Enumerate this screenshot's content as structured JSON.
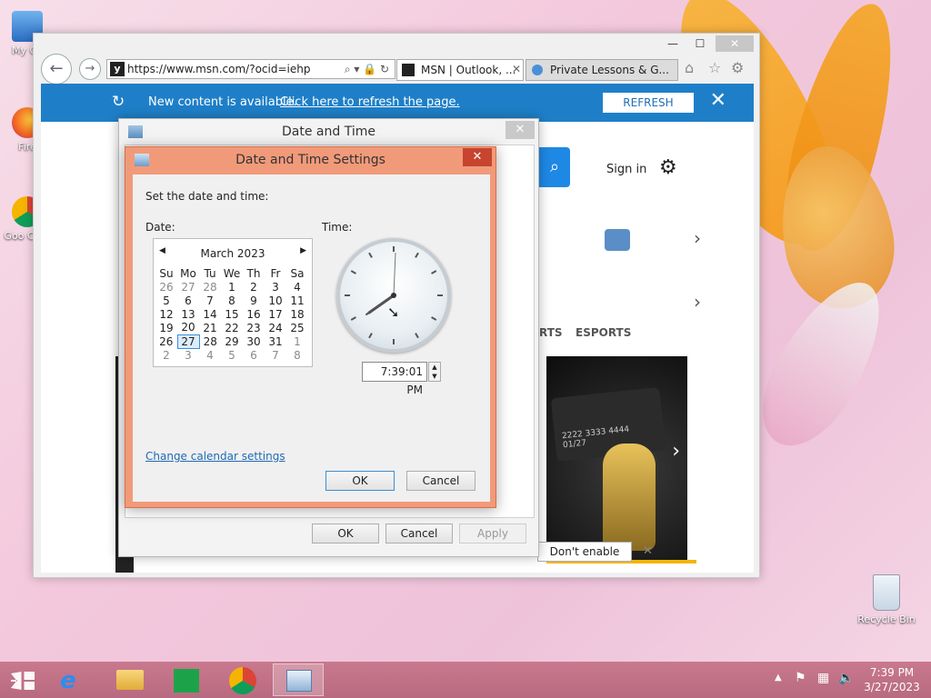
{
  "desktop": {
    "icons": [
      {
        "label": "My Co"
      },
      {
        "label": "Fire"
      },
      {
        "label": "Goo Chro"
      },
      {
        "label": "Recycle Bin"
      }
    ]
  },
  "browser": {
    "url": "https://www.msn.com/?ocid=iehp",
    "tabs": [
      {
        "label": "MSN | Outlook, ..."
      },
      {
        "label": "Private Lessons & G..."
      }
    ],
    "banner": {
      "text": "New content is available.",
      "link": "Click here to refresh the page.",
      "refresh_label": "REFRESH"
    },
    "page": {
      "sign_in": "Sign in",
      "nav": [
        "RTS",
        "ESPORTS"
      ],
      "card_number": "2222 3333 4444",
      "card_exp": "01/27",
      "dont_enable": "Don't enable"
    }
  },
  "outer_dialog": {
    "title": "Date and Time",
    "ok": "OK",
    "cancel": "Cancel",
    "apply": "Apply"
  },
  "inner_dialog": {
    "title": "Date and Time Settings",
    "instruction": "Set the date and time:",
    "date_label": "Date:",
    "time_label": "Time:",
    "month_label": "March 2023",
    "weekdays": [
      "Su",
      "Mo",
      "Tu",
      "We",
      "Th",
      "Fr",
      "Sa"
    ],
    "weeks": [
      [
        "26",
        "27",
        "28",
        "1",
        "2",
        "3",
        "4"
      ],
      [
        "5",
        "6",
        "7",
        "8",
        "9",
        "10",
        "11"
      ],
      [
        "12",
        "13",
        "14",
        "15",
        "16",
        "17",
        "18"
      ],
      [
        "19",
        "20",
        "21",
        "22",
        "23",
        "24",
        "25"
      ],
      [
        "26",
        "27",
        "28",
        "29",
        "30",
        "31",
        "1"
      ],
      [
        "2",
        "3",
        "4",
        "5",
        "6",
        "7",
        "8"
      ]
    ],
    "selected_day": "27",
    "time_value": "7:39:01 PM",
    "change_calendar": "Change calendar settings",
    "ok": "OK",
    "cancel": "Cancel"
  },
  "taskbar": {
    "time": "7:39 PM",
    "date": "3/27/2023",
    "apps": [
      "start",
      "internet-explorer",
      "file-explorer",
      "store",
      "chrome",
      "date-time-settings"
    ]
  }
}
